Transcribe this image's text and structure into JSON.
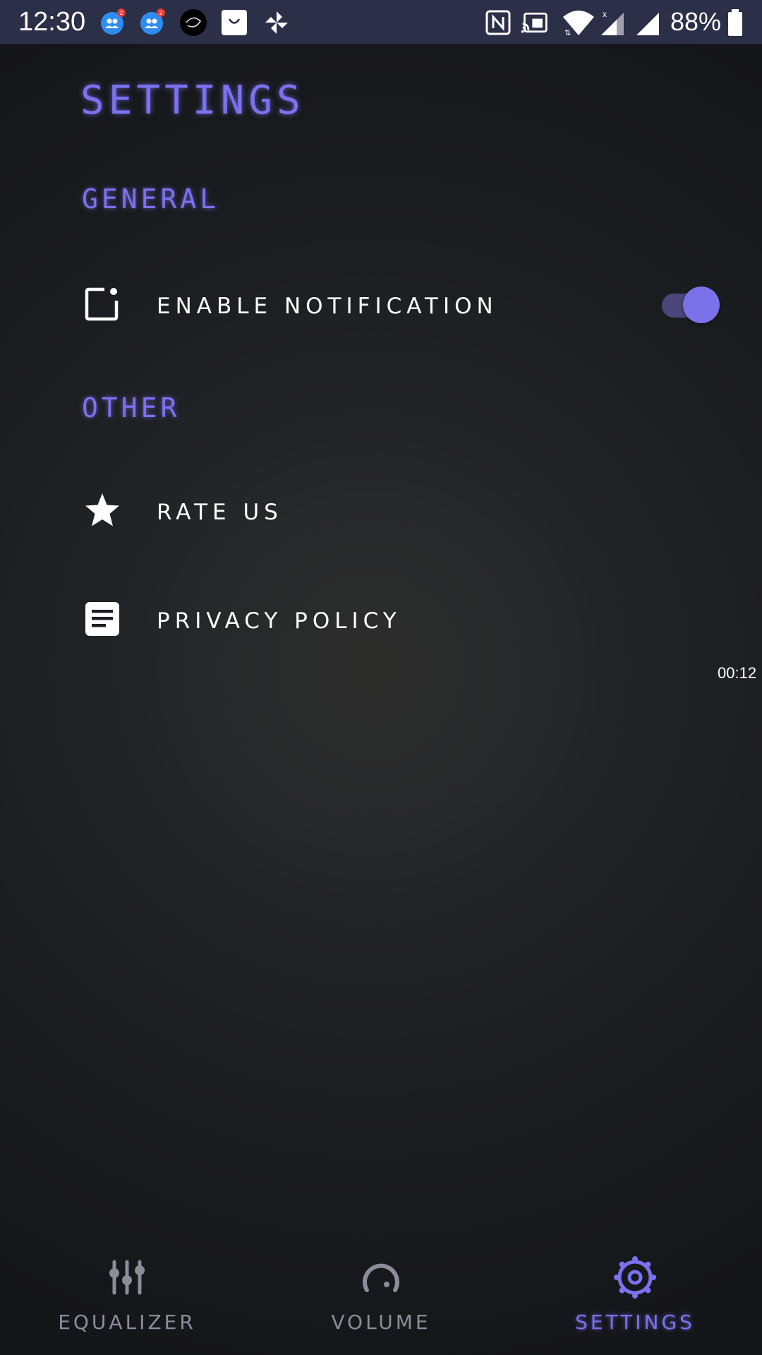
{
  "status_bar": {
    "time": "12:30",
    "battery_percent": "88%",
    "icons_left": [
      "messenger-icon",
      "messenger-icon",
      "app-circle-icon",
      "shopping-bag-icon",
      "pinwheel-icon"
    ],
    "icons_right": [
      "nfc-icon",
      "cast-icon",
      "wifi-icon",
      "signal-icon",
      "signal-icon",
      "battery-icon"
    ],
    "badge_count": "2"
  },
  "page": {
    "title": "SETTINGS"
  },
  "sections": {
    "general": {
      "title": "GENERAL",
      "notification_label": "ENABLE NOTIFICATION",
      "notification_enabled": true
    },
    "other": {
      "title": "OTHER",
      "rate_label": "RATE US",
      "privacy_label": "PRIVACY POLICY"
    }
  },
  "overlay": {
    "timer": "00:12"
  },
  "bottom_nav": {
    "items": [
      {
        "label": "EQUALIZER",
        "icon": "sliders-icon",
        "active": false
      },
      {
        "label": "VOLUME",
        "icon": "dial-icon",
        "active": false
      },
      {
        "label": "SETTINGS",
        "icon": "gear-icon",
        "active": true
      }
    ]
  },
  "colors": {
    "accent": "#7a72f0",
    "status_bar_bg": "#2c2f48",
    "inactive_nav": "#8a8d9a",
    "text": "#ffffff"
  }
}
